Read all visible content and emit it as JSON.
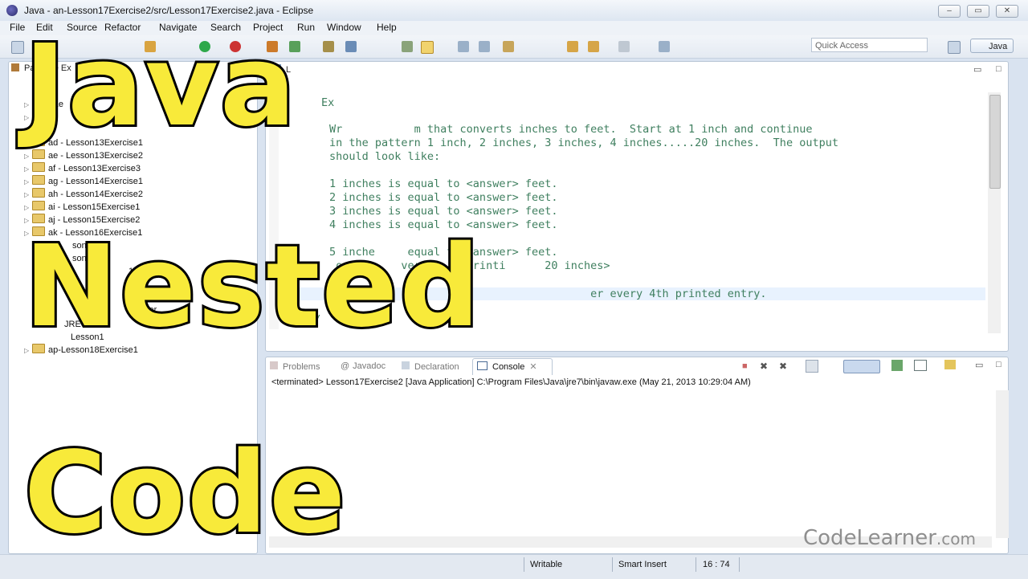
{
  "window": {
    "title": "Java - an-Lesson17Exercise2/src/Lesson17Exercise2.java - Eclipse",
    "controls": [
      "–",
      "▭",
      "✕"
    ]
  },
  "menu": [
    "File",
    "Edit",
    "Source",
    "Refactor",
    "Navigate",
    "Search",
    "Project",
    "Run",
    "Window",
    "Help"
  ],
  "toolbar": {
    "quick_access_placeholder": "Quick Access",
    "perspective_label": "Java"
  },
  "package_explorer": {
    "tab_label": "Package Ex",
    "rows": [
      {
        "label": "- Le",
        "partial": true
      },
      {
        "label": "",
        "partial": true
      },
      {
        "label": "",
        "partial": true
      },
      {
        "label": "ad - Lesson13Exercise1"
      },
      {
        "label": "ae - Lesson13Exercise2"
      },
      {
        "label": "af - Lesson13Exercise3"
      },
      {
        "label": "ag - Lesson14Exercise1"
      },
      {
        "label": "ah - Lesson14Exercise2"
      },
      {
        "label": "ai - Lesson15Exercise1"
      },
      {
        "label": "aj - Lesson15Exercise2"
      },
      {
        "label": "ak - Lesson16Exercise1"
      },
      {
        "label": "son16",
        "partial": true
      },
      {
        "label": "son17",
        "partial": true
      },
      {
        "label": "17",
        "partial": true
      },
      {
        "label": "",
        "partial": true
      },
      {
        "label": "age",
        "partial": true
      },
      {
        "label": "xer",
        "partial": true
      },
      {
        "label": "JRE S",
        "partial": true
      },
      {
        "label": "Lesson1",
        "partial": true
      },
      {
        "label": "ap-Lesson18Exercise1"
      }
    ]
  },
  "editor": {
    "tab_label": "L",
    "lines": [
      "Ex",
      "Wr           m that converts inches to feet.  Start at 1 inch and continue",
      "in the pattern 1 inch, 2 inches, 3 inches, 4 inches.....20 inches.  The output",
      "should look like:",
      "",
      "1 inches is equal to <answer> feet.",
      "2 inches is equal to <answer> feet.",
      "3 inches is equal to <answer> feet.",
      "4 inches is equal to <answer> feet.",
      "",
      "5 inche     equal to <answer> feet.",
      " ont       veri      printi      20 inches>",
      "",
      "No te:                                  er every 4th printed entry.",
      " */"
    ]
  },
  "console": {
    "tabs": [
      {
        "label": "Problems",
        "active": false
      },
      {
        "label": "Javadoc",
        "active": false
      },
      {
        "label": "Declaration",
        "active": false
      },
      {
        "label": "Console",
        "active": true
      }
    ],
    "status_line": "<terminated> Lesson17Exercise2 [Java Application] C:\\Program Files\\Java\\jre7\\bin\\javaw.exe (May 21, 2013 10:29:04 AM)"
  },
  "statusbar": {
    "writable": "Writable",
    "insert_mode": "Smart Insert",
    "position": "16 : 74"
  },
  "overlay": {
    "line1": "Java",
    "line2": "Nested",
    "line3": "Code",
    "color": "#f8ea3a"
  },
  "watermark": {
    "text": "CodeLearner",
    "suffix": ".com"
  }
}
